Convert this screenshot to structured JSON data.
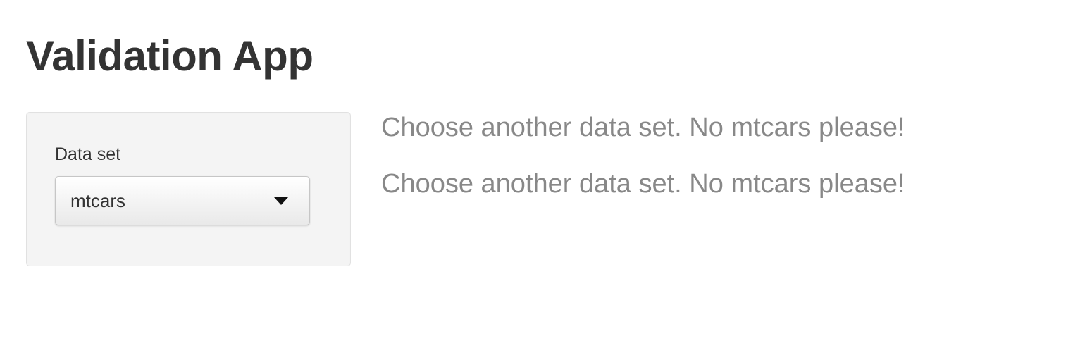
{
  "page": {
    "title": "Validation App"
  },
  "sidebar": {
    "dataset_label": "Data set",
    "dataset_select": {
      "selected_value": "mtcars",
      "icon": "caret-down-icon"
    }
  },
  "main": {
    "messages": [
      "Choose another data set. No mtcars please!",
      "Choose another data set. No mtcars please!"
    ]
  },
  "colors": {
    "title": "#333333",
    "panel_background": "#f4f4f4",
    "panel_border": "#e1e1e1",
    "message_text": "#888888"
  }
}
